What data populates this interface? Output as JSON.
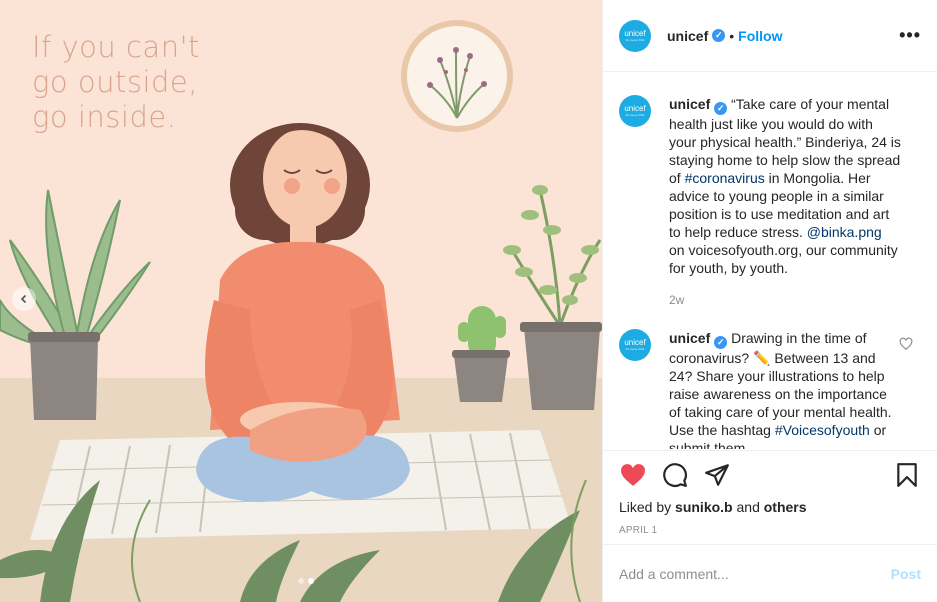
{
  "media": {
    "headline": [
      "If you can't",
      "go outside,",
      "go inside."
    ],
    "slide_count": 2,
    "active_slide": 1
  },
  "post": {
    "username": "unicef",
    "avatar_text": "unicef",
    "avatar_subtext": "for every child",
    "follow_label": "Follow",
    "separator": "•",
    "more_label": "•••"
  },
  "comments": [
    {
      "username": "unicef",
      "parts": [
        {
          "text": " “Take care of your mental health just like you would do with your physical health.” Binderiya, 24 is staying home to help slow the spread of "
        },
        {
          "text": "#coronavirus",
          "link": true
        },
        {
          "text": " in Mongolia. Her advice to young people in a similar position is to use meditation and art to help reduce stress. "
        },
        {
          "text": "@binka.png",
          "link": true
        },
        {
          "text": " on voicesofyouth.org, our community for youth, by youth."
        }
      ],
      "time": "2w"
    },
    {
      "username": "unicef",
      "parts": [
        {
          "text": " Drawing in the time of coronavirus? ✏️ Between 13 and 24? Share your illustrations to help raise awareness on the importance of taking care of your mental health. Use the hashtag "
        },
        {
          "text": "#Voicesofyouth",
          "link": true
        },
        {
          "text": " or submit them"
        }
      ],
      "time": ""
    }
  ],
  "actions": {
    "liked_prefix": "Liked by ",
    "liked_user": "suniko.b",
    "liked_join": " and ",
    "liked_others": "others",
    "date": "APRIL 1"
  },
  "add_comment": {
    "placeholder": "Add a comment...",
    "post_label": "Post"
  },
  "colors": {
    "accent": "#0095f6",
    "like_red": "#ed4956",
    "unicef_blue": "#1cabe2"
  }
}
